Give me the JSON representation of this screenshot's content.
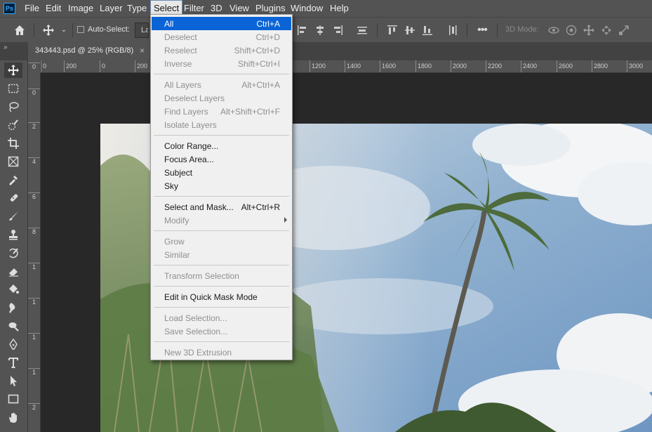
{
  "app": {
    "logo": "Ps"
  },
  "menubar": {
    "items": [
      "File",
      "Edit",
      "Image",
      "Layer",
      "Type",
      "Select",
      "Filter",
      "3D",
      "View",
      "Plugins",
      "Window",
      "Help"
    ],
    "active": "Select"
  },
  "options_bar": {
    "auto_select_label": "Auto-Select:",
    "layer_dropdown_value": "Layer",
    "mode_3d_label": "3D Mode:",
    "icons": [
      "home-icon",
      "move-tool-icon",
      "chevron-down-icon",
      "align-left-icon",
      "align-center-icon",
      "align-right-icon",
      "distribute-icon",
      "align-top-icon",
      "align-middle-icon",
      "align-bottom-icon",
      "distribute-vertical-icon",
      "more-icon",
      "orbit-icon",
      "roll-icon",
      "pan-icon",
      "slide-icon",
      "scale-icon"
    ]
  },
  "document_tab": {
    "title": "343443.psd @ 25% (RGB/8)",
    "close": "×"
  },
  "panel_collapse": "»",
  "ruler_top": {
    "labels": [
      "0",
      "200",
      "0",
      "200",
      "1200",
      "1400",
      "1600",
      "1800",
      "2000",
      "2200",
      "2400",
      "2600",
      "2800",
      "3000"
    ]
  },
  "ruler_left": {
    "labels": [
      "0",
      "2",
      "4",
      "6",
      "8",
      "1",
      "1",
      "1",
      "1",
      "1",
      "2"
    ]
  },
  "tools": [
    "move-tool-icon",
    "marquee-tool-icon",
    "lasso-tool-icon",
    "quick-select-tool-icon",
    "crop-tool-icon",
    "frame-tool-icon",
    "eyedropper-tool-icon",
    "healing-brush-tool-icon",
    "brush-tool-icon",
    "clone-stamp-tool-icon",
    "history-brush-tool-icon",
    "eraser-tool-icon",
    "paint-bucket-tool-icon",
    "blur-tool-icon",
    "dodge-tool-icon",
    "pen-tool-icon",
    "type-tool-icon",
    "path-select-tool-icon",
    "rectangle-tool-icon",
    "hand-tool-icon"
  ],
  "select_menu": {
    "items": [
      {
        "label": "All",
        "shortcut": "Ctrl+A",
        "state": "highlighted"
      },
      {
        "label": "Deselect",
        "shortcut": "Ctrl+D",
        "state": "disabled"
      },
      {
        "label": "Reselect",
        "shortcut": "Shift+Ctrl+D",
        "state": "disabled"
      },
      {
        "label": "Inverse",
        "shortcut": "Shift+Ctrl+I",
        "state": "disabled"
      },
      {
        "label": "All Layers",
        "shortcut": "Alt+Ctrl+A",
        "state": "disabled"
      },
      {
        "label": "Deselect Layers",
        "shortcut": "",
        "state": "disabled"
      },
      {
        "label": "Find Layers",
        "shortcut": "Alt+Shift+Ctrl+F",
        "state": "disabled"
      },
      {
        "label": "Isolate Layers",
        "shortcut": "",
        "state": "disabled"
      },
      {
        "label": "Color Range...",
        "shortcut": "",
        "state": "enabled"
      },
      {
        "label": "Focus Area...",
        "shortcut": "",
        "state": "enabled"
      },
      {
        "label": "Subject",
        "shortcut": "",
        "state": "enabled"
      },
      {
        "label": "Sky",
        "shortcut": "",
        "state": "enabled"
      },
      {
        "label": "Select and Mask...",
        "shortcut": "Alt+Ctrl+R",
        "state": "enabled"
      },
      {
        "label": "Modify",
        "shortcut": "",
        "state": "disabled"
      },
      {
        "label": "Grow",
        "shortcut": "",
        "state": "disabled"
      },
      {
        "label": "Similar",
        "shortcut": "",
        "state": "disabled"
      },
      {
        "label": "Transform Selection",
        "shortcut": "",
        "state": "disabled"
      },
      {
        "label": "Edit in Quick Mask Mode",
        "shortcut": "",
        "state": "enabled"
      },
      {
        "label": "Load Selection...",
        "shortcut": "",
        "state": "disabled"
      },
      {
        "label": "Save Selection...",
        "shortcut": "",
        "state": "disabled"
      },
      {
        "label": "New 3D Extrusion",
        "shortcut": "",
        "state": "disabled"
      }
    ]
  },
  "colors": {
    "menu_highlight": "#0a64d6",
    "panel_bg": "#535353",
    "canvas_bg": "#282828",
    "menu_bg": "#f0f0f0"
  }
}
